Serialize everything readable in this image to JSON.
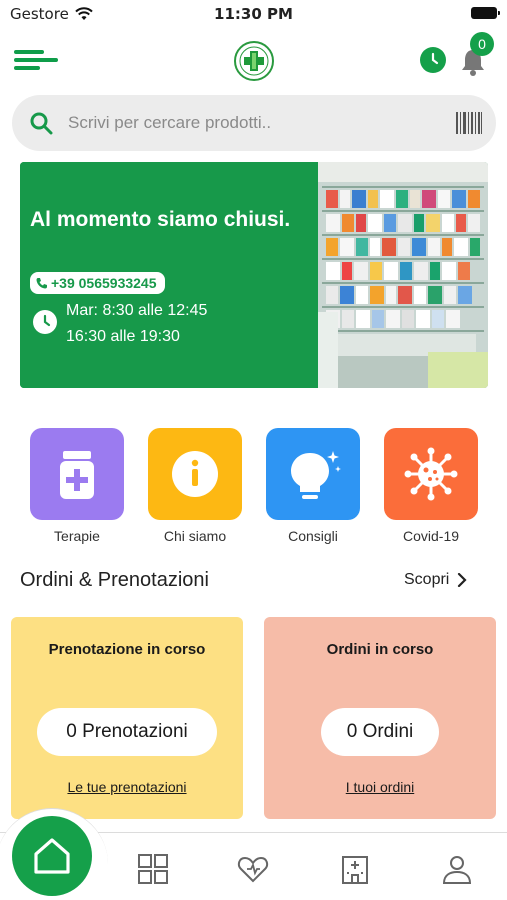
{
  "status_bar": {
    "carrier": "Gestore",
    "time": "11:30 PM"
  },
  "header": {
    "cart_count": "0",
    "icons": [
      "menu-icon",
      "pharmacy-logo",
      "clock-icon",
      "bell-icon"
    ]
  },
  "search": {
    "placeholder": "Scrivi per cercare prodotti.."
  },
  "banner": {
    "status_message": "Al momento siamo chiusi.",
    "phone": "+39 0565933245",
    "hours_line1": "Mar: 8:30 alle 12:45",
    "hours_line2": "16:30 alle 19:30"
  },
  "categories": [
    {
      "label": "Terapie",
      "color": "#9b7bf0",
      "icon": "medicine-jar-icon"
    },
    {
      "label": "Chi siamo",
      "color": "#fdb813",
      "icon": "info-icon"
    },
    {
      "label": "Consigli",
      "color": "#2e95f3",
      "icon": "lightbulb-icon"
    },
    {
      "label": "Covid-19",
      "color": "#fb6d3a",
      "icon": "virus-icon"
    }
  ],
  "orders_section": {
    "title": "Ordini & Prenotazioni",
    "discover_label": "Scopri",
    "bookings": {
      "title": "Prenotazione in corso",
      "count_label": "0 Prenotazioni",
      "link": "Le tue prenotazioni",
      "color": "#fde083"
    },
    "orders": {
      "title": "Ordini in corso",
      "count_label": "0 Ordini",
      "link": "I tuoi ordini",
      "color": "#f6bca8"
    }
  },
  "bottom_nav": {
    "items": [
      "home-icon",
      "grid-icon",
      "heart-icon",
      "hospital-icon",
      "profile-icon"
    ]
  },
  "colors": {
    "brand_green": "#17994a",
    "search_bg": "#ececec"
  }
}
